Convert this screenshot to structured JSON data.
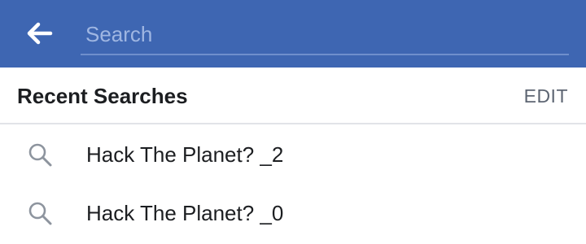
{
  "header": {
    "back_icon": "arrow-left-icon",
    "search": {
      "placeholder": "Search",
      "value": ""
    }
  },
  "recent": {
    "title": "Recent Searches",
    "edit_label": "EDIT",
    "items": [
      {
        "icon": "search-icon",
        "label": "Hack The Planet? _2"
      },
      {
        "icon": "search-icon",
        "label": "Hack The Planet? _0"
      }
    ]
  },
  "colors": {
    "header_bg": "#3e66b2",
    "placeholder": "#9fb6e2",
    "divider": "#e2e4e8",
    "text_primary": "#1c1e21",
    "text_secondary": "#5d6572",
    "icon_gray": "#8d949e"
  }
}
